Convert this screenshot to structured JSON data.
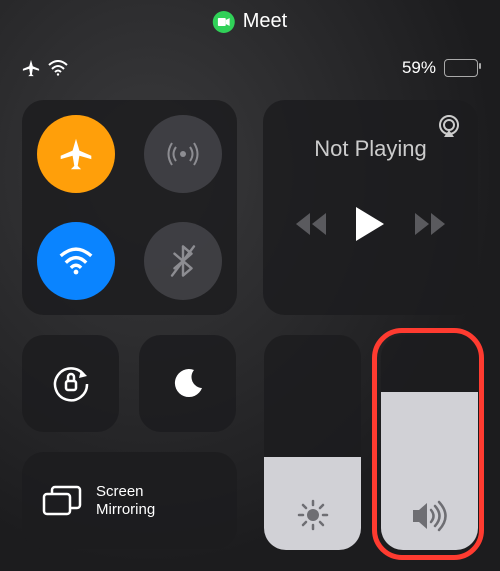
{
  "pill": {
    "app_name": "Meet"
  },
  "status": {
    "battery_percent_label": "59%",
    "battery_percent": 59
  },
  "connectivity": {
    "airplane_on": true,
    "cellular_on": false,
    "wifi_on": true,
    "bluetooth_on": false
  },
  "media": {
    "now_playing_label": "Not Playing"
  },
  "screen_mirroring": {
    "label_line1": "Screen",
    "label_line2": "Mirroring"
  },
  "sliders": {
    "brightness_percent": 35,
    "volume_percent": 65
  },
  "highlight": {
    "target": "volume-slider"
  }
}
